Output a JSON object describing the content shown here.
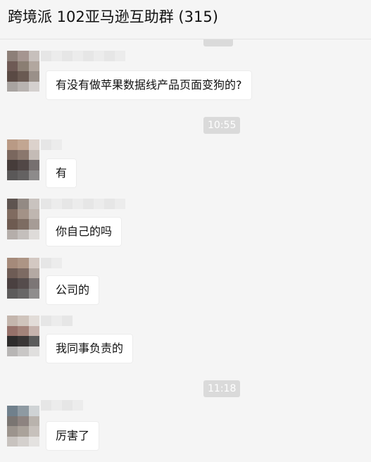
{
  "header": {
    "title": "跨境派 102亚马逊互助群 (315)"
  },
  "timestamps": [
    "10:55",
    "11:18"
  ],
  "messages": [
    {
      "text": "有没有做苹果数据线产品页面变狗的?"
    },
    {
      "text": "有"
    },
    {
      "text": "你自己的吗"
    },
    {
      "text": "公司的"
    },
    {
      "text": "我同事负责的"
    },
    {
      "text": "厉害了"
    }
  ],
  "colors": {
    "background": "#f5f5f5",
    "bubble": "#ffffff",
    "timestamp_bg": "#dadada",
    "timestamp_text": "#ffffff"
  }
}
